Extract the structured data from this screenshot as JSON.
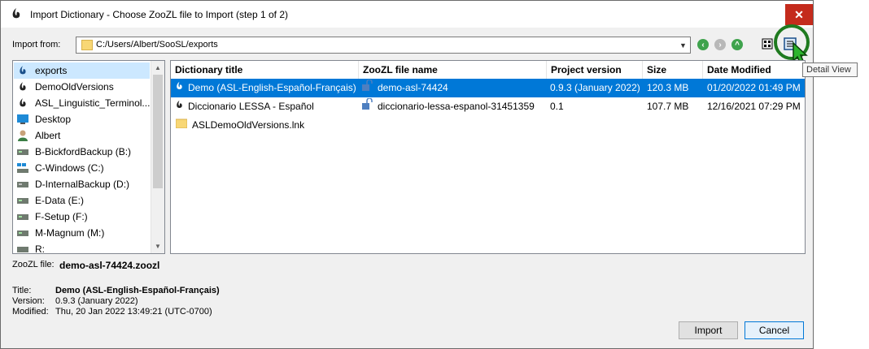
{
  "window": {
    "title": "Import Dictionary - Choose ZooZL file to Import (step 1 of 2)",
    "close_label": "✕"
  },
  "toolbar": {
    "import_from_label": "Import from:",
    "path": "C:/Users/Albert/SooSL/exports",
    "tooltip": "Detail View"
  },
  "tree": {
    "items": [
      {
        "label": "exports",
        "icon": "soosl-icon",
        "selected": true
      },
      {
        "label": "DemoOldVersions",
        "icon": "soosl-icon"
      },
      {
        "label": "ASL_Linguistic_Terminol...",
        "icon": "soosl-icon"
      },
      {
        "label": "Desktop",
        "icon": "desktop-icon"
      },
      {
        "label": "Albert",
        "icon": "user-icon"
      },
      {
        "label": "B-BickfordBackup (B:)",
        "icon": "drive-icon"
      },
      {
        "label": "C-Windows (C:)",
        "icon": "windows-drive-icon"
      },
      {
        "label": "D-InternalBackup (D:)",
        "icon": "drive-icon"
      },
      {
        "label": "E-Data (E:)",
        "icon": "drive-icon"
      },
      {
        "label": "F-Setup (F:)",
        "icon": "drive-icon"
      },
      {
        "label": "M-Magnum (M:)",
        "icon": "drive-icon"
      },
      {
        "label": "R:",
        "icon": "drive-icon"
      }
    ]
  },
  "table": {
    "columns": [
      "Dictionary title",
      "ZooZL file name",
      "Project version",
      "Size",
      "Date Modified"
    ],
    "rows": [
      {
        "title": "Demo (ASL-English-Español-Français)",
        "file": "demo-asl-74424",
        "version": "0.9.3 (January 2022)",
        "size": "120.3 MB",
        "date": "01/20/2022 01:49 PM",
        "selected": true
      },
      {
        "title": "Diccionario LESSA - Español",
        "file": "diccionario-lessa-espanol-31451359",
        "version": "0.1",
        "size": "107.7 MB",
        "date": "12/16/2021 07:29 PM"
      },
      {
        "title": "ASLDemoOldVersions.lnk",
        "file": "",
        "version": "",
        "size": "",
        "date": ""
      }
    ]
  },
  "details": {
    "file_label": "ZooZL file:",
    "file_value": "demo-asl-74424.zoozl",
    "title_label": "Title:",
    "title_value": "Demo (ASL-English-Español-Français)",
    "version_label": "Version:",
    "version_value": "0.9.3 (January 2022)",
    "modified_label": "Modified:",
    "modified_value": "Thu, 20 Jan 2022 13:49:21 (UTC-0700)"
  },
  "buttons": {
    "import": "Import",
    "cancel": "Cancel"
  },
  "colors": {
    "selection": "#0078d7",
    "nav_green": "#3fa34d",
    "close_red": "#c42b1c",
    "highlight_ring": "#1f7a1f"
  }
}
